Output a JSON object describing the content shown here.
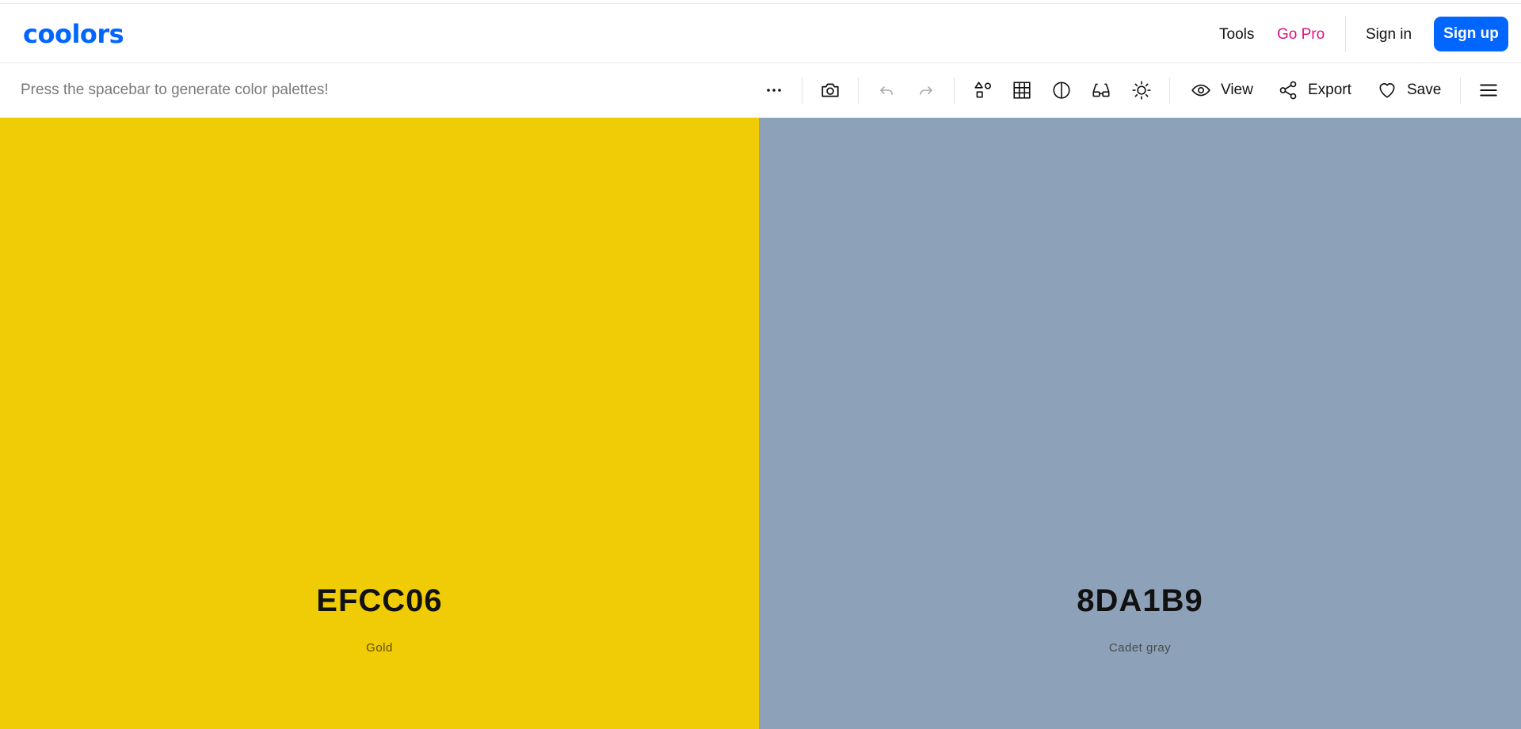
{
  "app": {
    "logo_text": "coolors",
    "brand_color": "#0066ff"
  },
  "header": {
    "nav": {
      "tools": "Tools",
      "go_pro": "Go Pro",
      "sign_in": "Sign in",
      "sign_up": "Sign up"
    },
    "go_pro_color": "#e0107b"
  },
  "toolbar": {
    "hint": "Press the spacebar to generate color palettes!",
    "icons": [
      "more-icon",
      "camera-icon",
      "undo-icon",
      "redo-icon",
      "shapes-icon",
      "grid-icon",
      "contrast-icon",
      "glasses-icon",
      "sun-icon",
      "eye-icon",
      "share-icon",
      "heart-icon",
      "menu-icon"
    ],
    "view_label": "View",
    "export_label": "Export",
    "save_label": "Save"
  },
  "palette": {
    "colors": [
      {
        "hex": "EFCC06",
        "name": "Gold",
        "color": "#EFCC06"
      },
      {
        "hex": "8DA1B9",
        "name": "Cadet gray",
        "color": "#8DA1B9"
      }
    ]
  }
}
